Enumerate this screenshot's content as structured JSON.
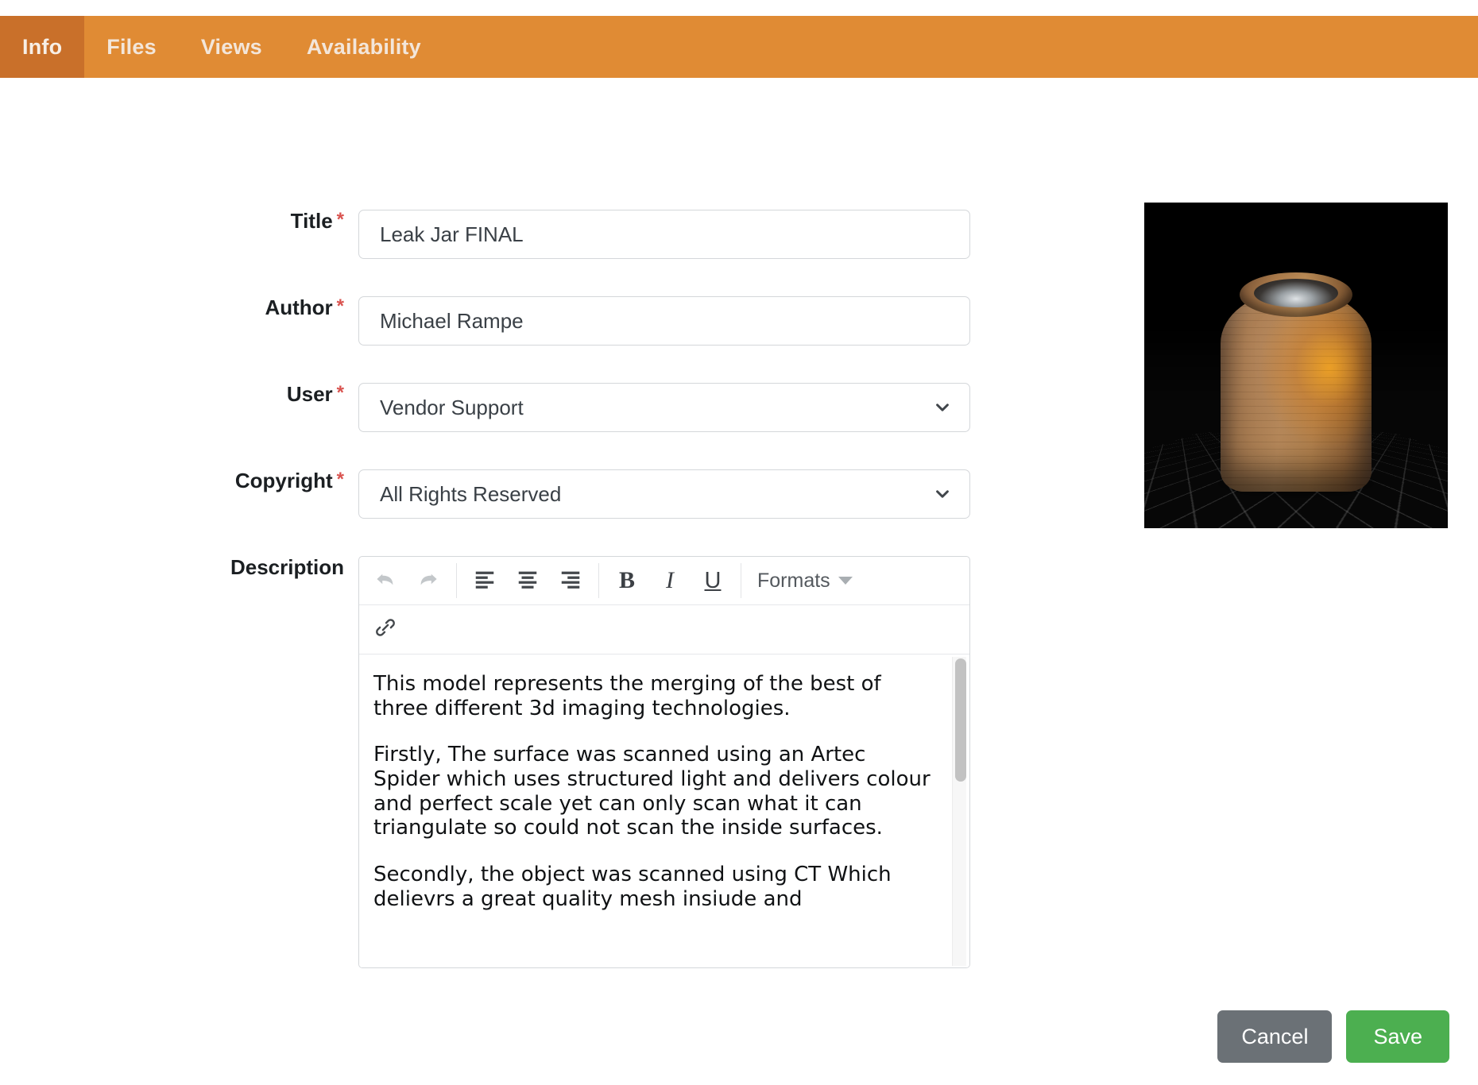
{
  "tabs": [
    {
      "label": "Info",
      "active": true
    },
    {
      "label": "Files",
      "active": false
    },
    {
      "label": "Views",
      "active": false
    },
    {
      "label": "Availability",
      "active": false
    }
  ],
  "colors": {
    "tabbar_bg": "#e08b34",
    "tab_active_bg": "#c9702a",
    "required_asterisk": "#d9534f",
    "save_button": "#4caf50",
    "cancel_button": "#6b7176"
  },
  "form": {
    "title": {
      "label": "Title",
      "required": "*",
      "value": "Leak Jar FINAL"
    },
    "author": {
      "label": "Author",
      "required": "*",
      "value": "Michael Rampe"
    },
    "user": {
      "label": "User",
      "required": "*",
      "value": "Vendor Support",
      "options": [
        "Vendor Support"
      ]
    },
    "copyright": {
      "label": "Copyright",
      "required": "*",
      "value": "All Rights Reserved",
      "options": [
        "All Rights Reserved"
      ]
    },
    "description": {
      "label": "Description",
      "toolbar": {
        "undo": "undo-icon",
        "redo": "redo-icon",
        "align_left": "align-left-icon",
        "align_center": "align-center-icon",
        "align_right": "align-right-icon",
        "bold": "B",
        "italic": "I",
        "underline": "U",
        "formats": "Formats",
        "link": "link-icon"
      },
      "paragraphs": [
        "This model represents the merging of the best of three different 3d imaging technologies.",
        "Firstly, The surface was scanned using an Artec Spider which uses structured light and delivers colour and perfect scale yet can only scan what it can triangulate so could not scan the inside surfaces.",
        "Secondly, the object was scanned using CT Which delievrs a great quality mesh insiude and"
      ]
    }
  },
  "thumbnail": {
    "alt": "3D scan preview of ceramic jar on dark grid background"
  },
  "footer": {
    "cancel_label": "Cancel",
    "save_label": "Save"
  }
}
